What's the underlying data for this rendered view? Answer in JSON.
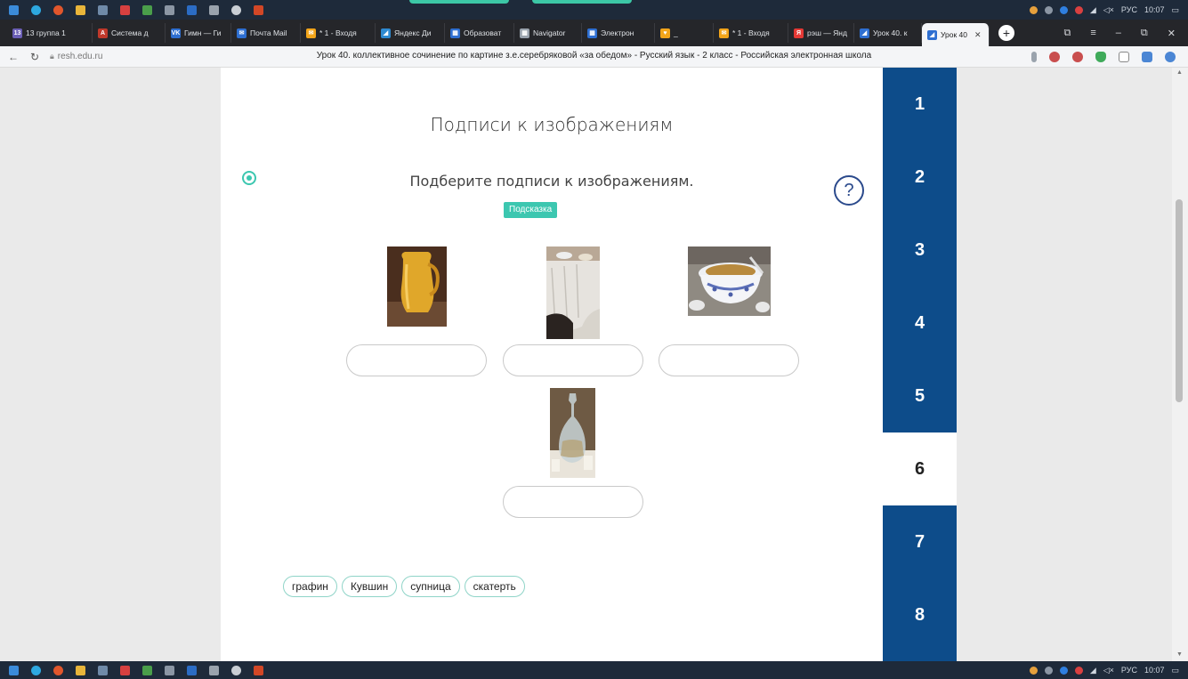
{
  "taskbar": {
    "tray_lang": "РУС",
    "tray_time": "10:07"
  },
  "tabs": [
    {
      "label": "13 группа 1",
      "color": "#6b5fb5",
      "fav": "13"
    },
    {
      "label": "Система д",
      "color": "#c0392b",
      "fav": "А"
    },
    {
      "label": "Гимн — Ги",
      "color": "#2e6fd1",
      "fav": "VK"
    },
    {
      "label": "Почта Mail",
      "color": "#2e6fd1",
      "fav": "✉"
    },
    {
      "label": "* 1 - Входя",
      "color": "#f3a51a",
      "fav": "✉"
    },
    {
      "label": "Яндекс Ди",
      "color": "#2e8ad1",
      "fav": "◢"
    },
    {
      "label": "Образоват",
      "color": "#2e6fd1",
      "fav": "▦"
    },
    {
      "label": "Navigator",
      "color": "#9aa3ad",
      "fav": "▦"
    },
    {
      "label": "Электрон",
      "color": "#2e6fd1",
      "fav": "▦"
    },
    {
      "label": "_",
      "color": "#f3a51a",
      "fav": "♥"
    },
    {
      "label": "* 1 - Входя",
      "color": "#f3a51a",
      "fav": "✉"
    },
    {
      "label": "рэш — Янд",
      "color": "#e53935",
      "fav": "Я"
    },
    {
      "label": "Урок 40. к",
      "color": "#2e6fd1",
      "fav": "◢"
    }
  ],
  "active_tab": {
    "label": "Урок 40",
    "close": "✕"
  },
  "address": {
    "url": "resh.edu.ru",
    "page_title": "Урок 40. коллективное сочинение по картине з.е.серебряковой «за обедом» - Русский язык - 2 класс - Российская электронная школа"
  },
  "main": {
    "section_title": "Подписи к изображениям",
    "instruction": "Подберите подписи к изображениям.",
    "hint_label": "Подсказка",
    "help_label": "?"
  },
  "images": [
    {
      "name": "jug-picture",
      "subject": "кувшин"
    },
    {
      "name": "tablecloth-picture",
      "subject": "скатерть"
    },
    {
      "name": "tureen-picture",
      "subject": "супница"
    },
    {
      "name": "decanter-picture",
      "subject": "графин"
    }
  ],
  "word_bank": [
    "графин",
    "Кувшин",
    "супница",
    "скатерть"
  ],
  "steps": [
    "1",
    "2",
    "3",
    "4",
    "5",
    "6",
    "7",
    "8"
  ],
  "active_step": "6",
  "colors": {
    "accent": "#3cc7b0",
    "nav_blue": "#0d4c8a",
    "help_blue": "#2b4a8c"
  }
}
